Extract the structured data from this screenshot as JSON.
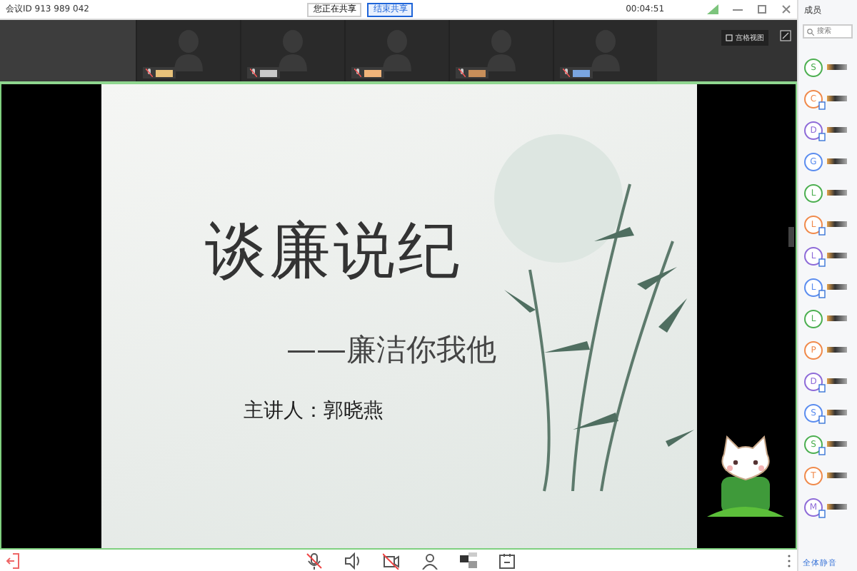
{
  "top_bar": {
    "meeting_id": "会议ID 913 989 042",
    "buttons": [
      {
        "label": "您正在共享",
        "kind": "plain"
      },
      {
        "label": "结束共享",
        "kind": "accent"
      }
    ],
    "timer": "00:04:51"
  },
  "video_strip": {
    "tiles": [
      {
        "muted": true
      },
      {
        "muted": true
      },
      {
        "muted": true
      },
      {
        "muted": true
      },
      {
        "muted": true
      }
    ],
    "view_button": "宫格视图"
  },
  "slide": {
    "title": "谈廉说纪",
    "subtitle": "——廉洁你我他",
    "speaker": "主讲人：郭晓燕"
  },
  "sidebar": {
    "title": "成员",
    "search": {
      "placeholder": "搜索"
    },
    "members": [
      {
        "initial": "S",
        "color": "#4caf50",
        "device": false
      },
      {
        "initial": "C",
        "color": "#f08a4b",
        "device": true
      },
      {
        "initial": "D",
        "color": "#8e6bd8",
        "device": true
      },
      {
        "initial": "G",
        "color": "#5b8def",
        "device": false
      },
      {
        "initial": "L",
        "color": "#4caf50",
        "device": false
      },
      {
        "initial": "L",
        "color": "#f08a4b",
        "device": true
      },
      {
        "initial": "L",
        "color": "#8e6bd8",
        "device": true
      },
      {
        "initial": "L",
        "color": "#5b8def",
        "device": true
      },
      {
        "initial": "L",
        "color": "#4caf50",
        "device": false
      },
      {
        "initial": "P",
        "color": "#f08a4b",
        "device": false
      },
      {
        "initial": "D",
        "color": "#8e6bd8",
        "device": true
      },
      {
        "initial": "S",
        "color": "#5b8def",
        "device": true
      },
      {
        "initial": "S",
        "color": "#4caf50",
        "device": true
      },
      {
        "initial": "T",
        "color": "#f08a4b",
        "device": false
      },
      {
        "initial": "M",
        "color": "#8e6bd8",
        "device": true
      }
    ],
    "footer": "全体静音"
  },
  "toolbar": {
    "tools": [
      {
        "kind": "mic"
      },
      {
        "kind": "speaker"
      },
      {
        "kind": "camera"
      },
      {
        "kind": "person"
      },
      {
        "kind": "share"
      },
      {
        "kind": "app"
      }
    ]
  }
}
